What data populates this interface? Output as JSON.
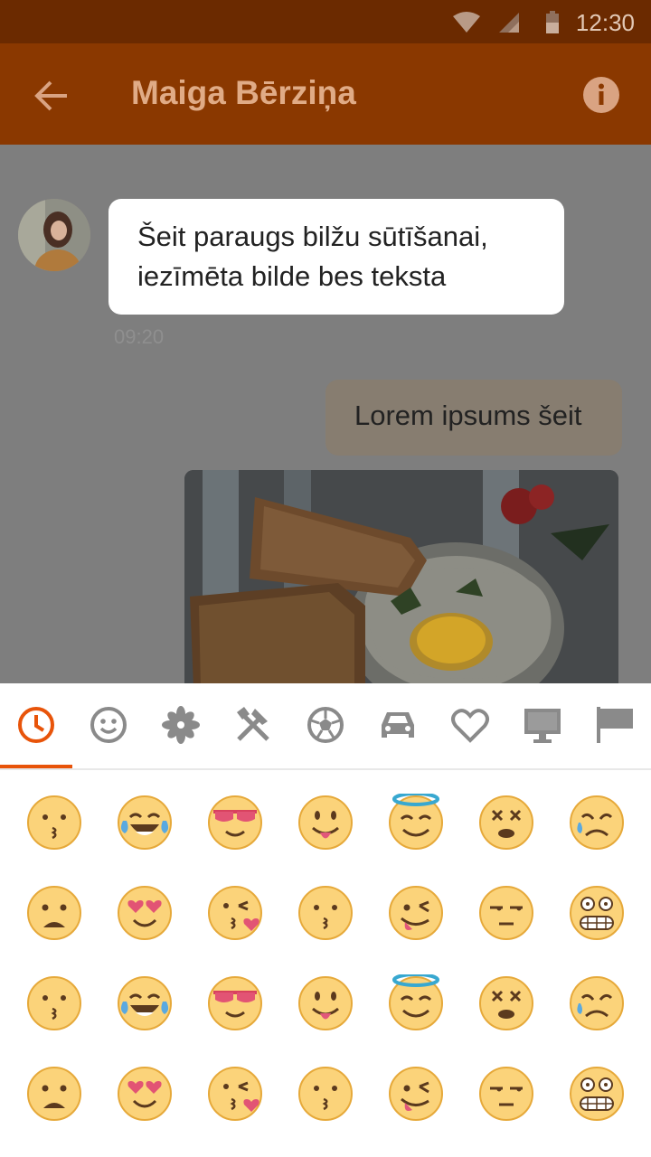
{
  "status_bar": {
    "time": "12:30"
  },
  "app_bar": {
    "title": "Maiga Bērziņa"
  },
  "chat": {
    "incoming": {
      "line1": "Šeit paraugs bilžu sūtīšanai,",
      "line2": "iezīmēta bilde bes teksta",
      "time": "09:20"
    },
    "outgoing": {
      "text": "Lorem ipsums šeit"
    }
  },
  "emoji_tabs": [
    "recent-icon",
    "smiley-icon",
    "flower-icon",
    "food-icon",
    "sports-icon",
    "car-icon",
    "heart-icon",
    "computer-icon",
    "flag-icon"
  ],
  "colors": {
    "accent": "#e8540a",
    "app_bar": "#8a3800",
    "status_bar": "#6b2a00",
    "emoji_face": "#fbd37a"
  },
  "emoji_rows": [
    [
      "kissing-face",
      "joy-face",
      "sunglasses-face",
      "tongue-face",
      "halo-face",
      "dizzy-face",
      "sad-sweat-face"
    ],
    [
      "frowning-face",
      "heart-eyes-face",
      "kissing-heart-face",
      "kissing-face",
      "wink-tongue-face",
      "unamused-face",
      "grimacing-face"
    ],
    [
      "kissing-face",
      "joy-face",
      "sunglasses-face",
      "tongue-face",
      "halo-face",
      "dizzy-face",
      "sad-sweat-face"
    ],
    [
      "frowning-face",
      "heart-eyes-face",
      "kissing-heart-face",
      "kissing-face",
      "wink-tongue-face",
      "unamused-face",
      "grimacing-face"
    ]
  ]
}
